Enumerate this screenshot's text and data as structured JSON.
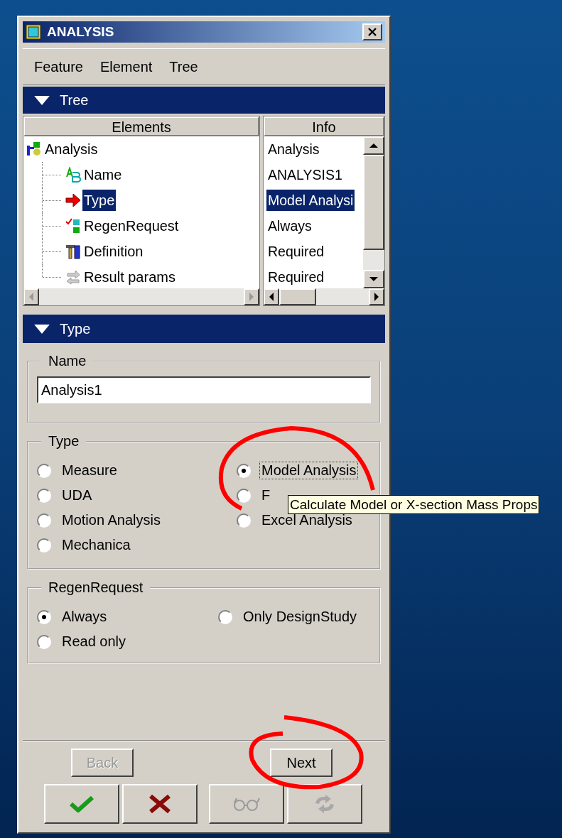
{
  "window": {
    "title": "ANALYSIS"
  },
  "menu": [
    {
      "label": "Feature"
    },
    {
      "label": "Element"
    },
    {
      "label": "Tree"
    }
  ],
  "tree_section": {
    "label": "Tree",
    "expanded": true
  },
  "tree": {
    "columns": [
      "Elements",
      "Info"
    ],
    "items": [
      {
        "label": "Analysis",
        "info": "Analysis",
        "kind": "feature",
        "selected": false,
        "children": [
          {
            "label": "Name",
            "info": "ANALYSIS1",
            "kind": "text",
            "selected": false
          },
          {
            "label": "Type",
            "info": "Model Analysi",
            "kind": "arrow",
            "selected": true
          },
          {
            "label": "RegenRequest",
            "info": "Always",
            "kind": "regen",
            "selected": false
          },
          {
            "label": "Definition",
            "info": "Required",
            "kind": "definition",
            "selected": false
          },
          {
            "label": "Result params",
            "info": "Required",
            "kind": "result",
            "selected": false
          }
        ]
      }
    ]
  },
  "type_section": {
    "label": "Type",
    "expanded": true
  },
  "name_group": {
    "label": "Name",
    "value": "Analysis1"
  },
  "type_group": {
    "label": "Type",
    "options": [
      {
        "label": "Measure",
        "selected": false
      },
      {
        "label": "Model Analysis",
        "selected": true
      },
      {
        "label": "UDA",
        "selected": false
      },
      {
        "label": "F",
        "selected": false
      },
      {
        "label": "Motion Analysis",
        "selected": false
      },
      {
        "label": "Excel Analysis",
        "selected": false
      },
      {
        "label": "Mechanica",
        "selected": false
      }
    ]
  },
  "tooltip": "Calculate Model or X-section Mass Props",
  "regen_group": {
    "label": "RegenRequest",
    "options": [
      {
        "label": "Always",
        "selected": true
      },
      {
        "label": "Only DesignStudy",
        "selected": false
      },
      {
        "label": "Read only",
        "selected": false
      }
    ]
  },
  "nav_buttons": [
    {
      "label": "Back",
      "disabled": true
    },
    {
      "label": "Next",
      "disabled": false
    }
  ],
  "action_buttons": [
    {
      "kind": "ok",
      "disabled": false
    },
    {
      "kind": "cancel",
      "disabled": false
    },
    {
      "kind": "preview",
      "disabled": true
    },
    {
      "kind": "repaint",
      "disabled": true
    }
  ]
}
